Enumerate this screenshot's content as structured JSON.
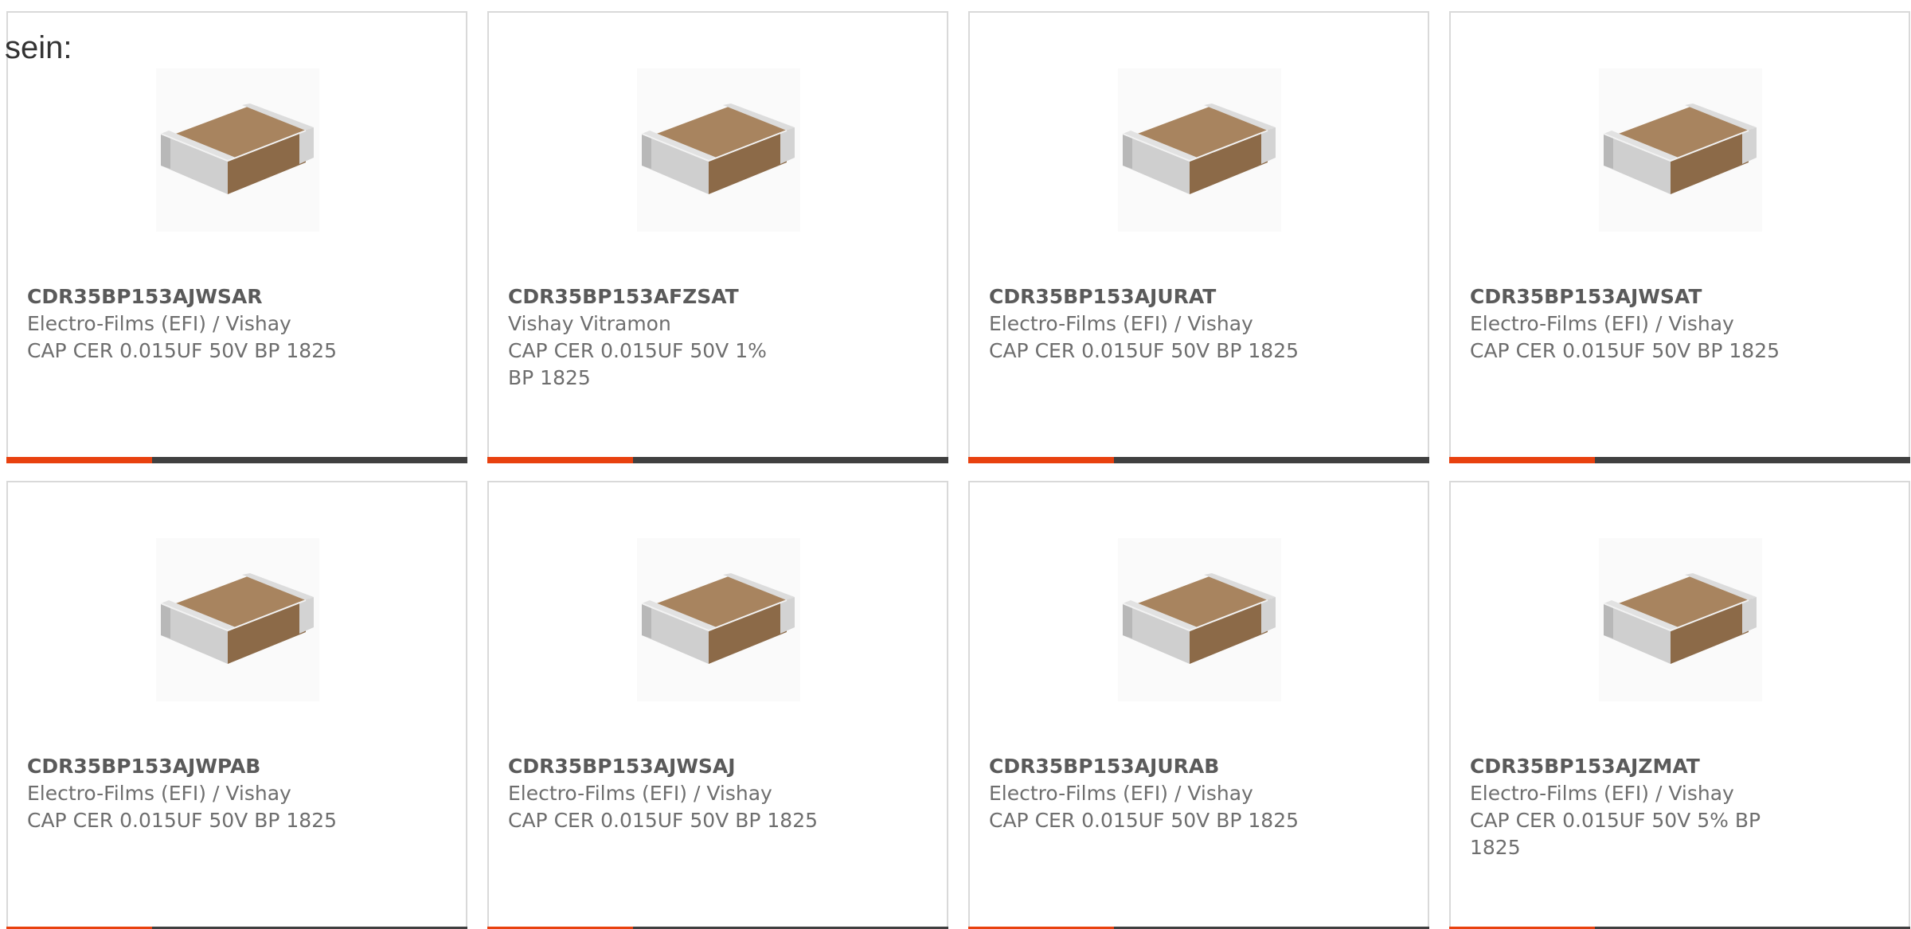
{
  "intro_text": "sein:",
  "colors": {
    "accent": "#e8410f",
    "bar": "#404040",
    "border": "#d9d9d9"
  },
  "products": [
    {
      "part": "CDR35BP153AJWSAR",
      "manufacturer": "Electro-Films (EFI) / Vishay",
      "description": "CAP CER 0.015UF 50V BP 1825",
      "image": "ceramic-capacitor-image"
    },
    {
      "part": "CDR35BP153AFZSAT",
      "manufacturer": "Vishay Vitramon",
      "description": "CAP CER 0.015UF 50V 1% BP 1825",
      "image": "ceramic-capacitor-image"
    },
    {
      "part": "CDR35BP153AJURAT",
      "manufacturer": "Electro-Films (EFI) / Vishay",
      "description": "CAP CER 0.015UF 50V BP 1825",
      "image": "ceramic-capacitor-image"
    },
    {
      "part": "CDR35BP153AJWSAT",
      "manufacturer": "Electro-Films (EFI) / Vishay",
      "description": "CAP CER 0.015UF 50V BP 1825",
      "image": "ceramic-capacitor-image"
    },
    {
      "part": "CDR35BP153AJWPAB",
      "manufacturer": "Electro-Films (EFI) / Vishay",
      "description": "CAP CER 0.015UF 50V BP 1825",
      "image": "ceramic-capacitor-image"
    },
    {
      "part": "CDR35BP153AJWSAJ",
      "manufacturer": "Electro-Films (EFI) / Vishay",
      "description": "CAP CER 0.015UF 50V BP 1825",
      "image": "ceramic-capacitor-image"
    },
    {
      "part": "CDR35BP153AJURAB",
      "manufacturer": "Electro-Films (EFI) / Vishay",
      "description": "CAP CER 0.015UF 50V BP 1825",
      "image": "ceramic-capacitor-image"
    },
    {
      "part": "CDR35BP153AJZMAT",
      "manufacturer": "Electro-Films (EFI) / Vishay",
      "description": "CAP CER 0.015UF 50V 5% BP 1825",
      "image": "ceramic-capacitor-image"
    }
  ]
}
